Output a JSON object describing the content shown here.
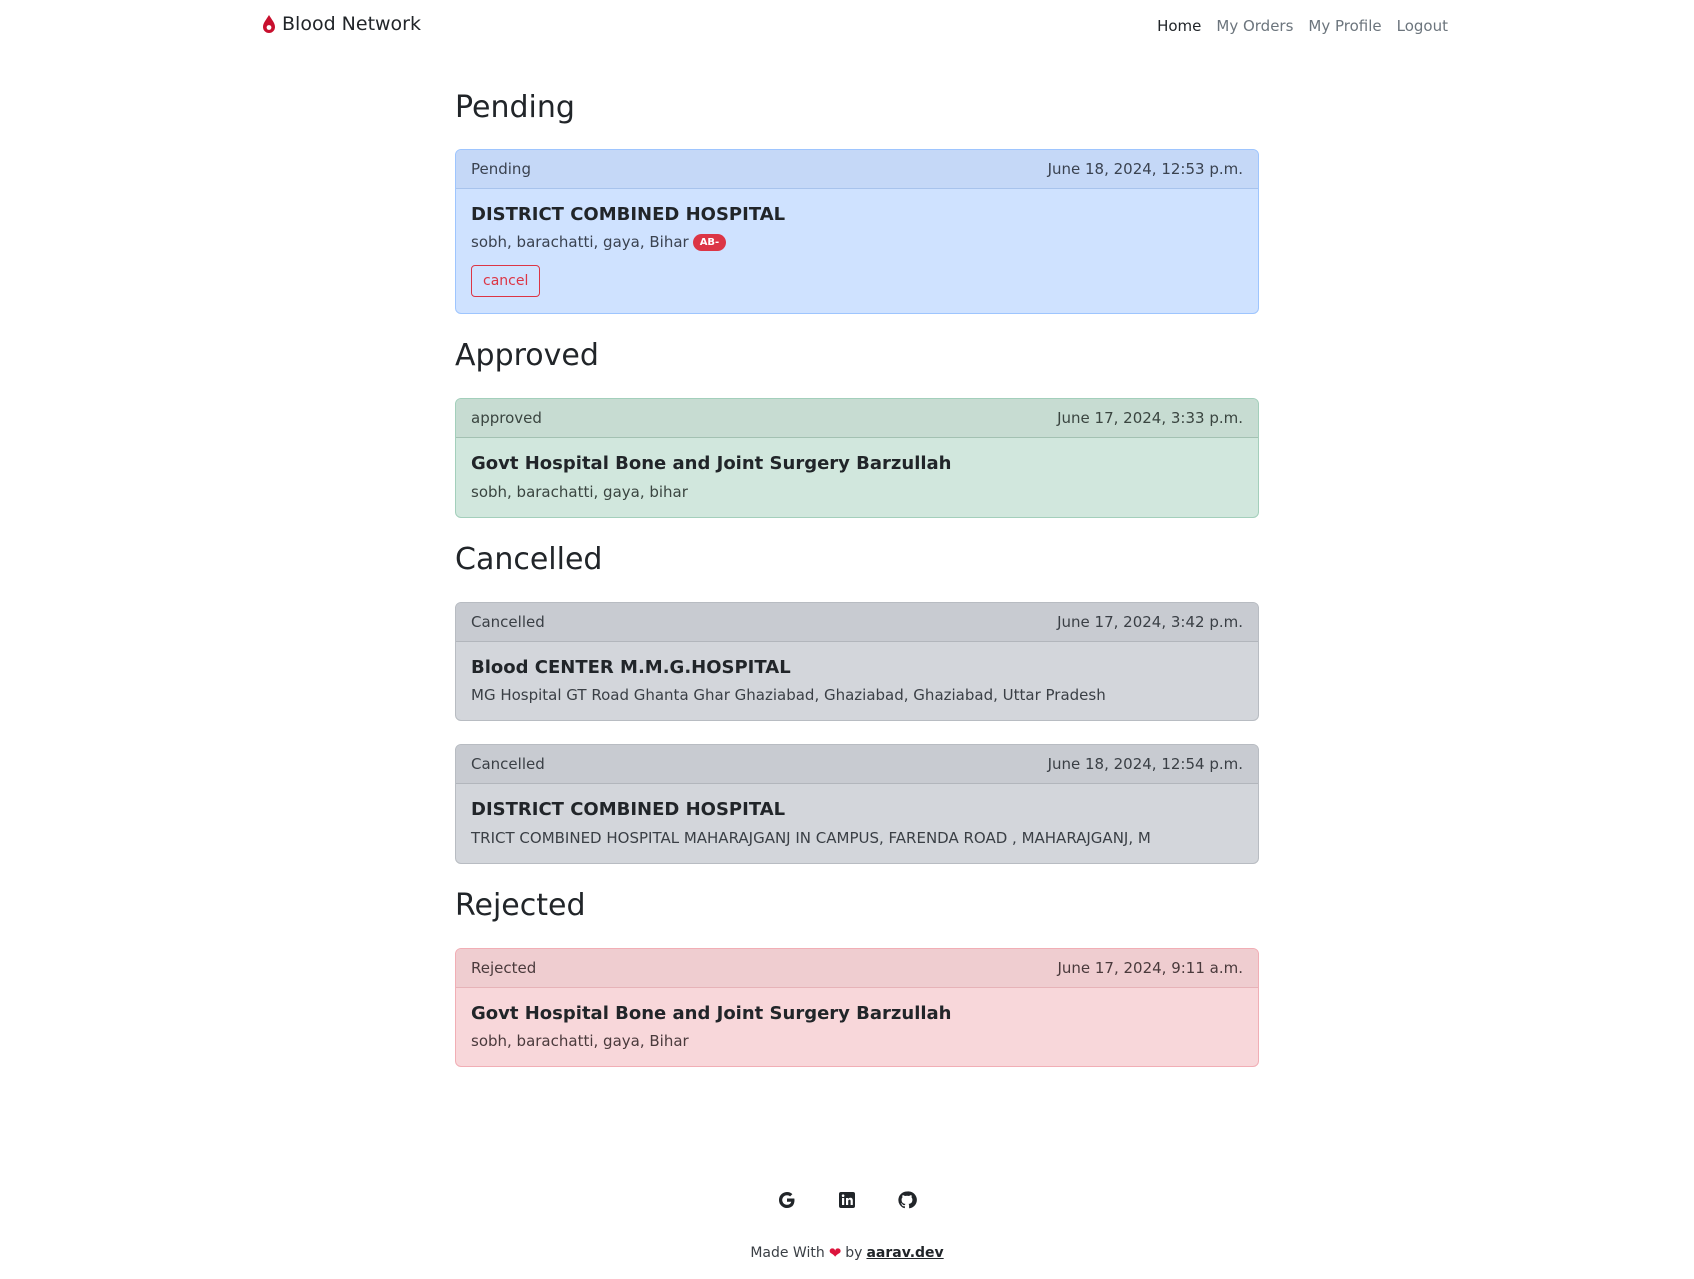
{
  "nav": {
    "brand": "Blood Network",
    "links": [
      "Home",
      "My Orders",
      "My Profile",
      "Logout"
    ]
  },
  "sections": {
    "pending": {
      "title": "Pending",
      "cards": [
        {
          "status": "Pending",
          "date": "June 18, 2024, 12:53 p.m.",
          "hospital": "DISTRICT COMBINED HOSPITAL",
          "address": "sobh, barachatti, gaya, Bihar",
          "blood_group": "AB-",
          "cancel_label": "cancel"
        }
      ]
    },
    "approved": {
      "title": "Approved",
      "cards": [
        {
          "status": "approved",
          "date": "June 17, 2024, 3:33 p.m.",
          "hospital": "Govt Hospital Bone and Joint Surgery Barzullah",
          "address": "sobh, barachatti, gaya, bihar"
        }
      ]
    },
    "cancelled": {
      "title": "Cancelled",
      "cards": [
        {
          "status": "Cancelled",
          "date": "June 17, 2024, 3:42 p.m.",
          "hospital": "Blood CENTER M.M.G.HOSPITAL",
          "address": "MG Hospital GT Road Ghanta Ghar Ghaziabad, Ghaziabad, Ghaziabad, Uttar Pradesh"
        },
        {
          "status": "Cancelled",
          "date": "June 18, 2024, 12:54 p.m.",
          "hospital": "DISTRICT COMBINED HOSPITAL",
          "address": "TRICT COMBINED HOSPITAL MAHARAJGANJ IN CAMPUS, FARENDA ROAD , MAHARAJGANJ, M"
        }
      ]
    },
    "rejected": {
      "title": "Rejected",
      "cards": [
        {
          "status": "Rejected",
          "date": "June 17, 2024, 9:11 a.m.",
          "hospital": "Govt Hospital Bone and Joint Surgery Barzullah",
          "address": "sobh, barachatti, gaya, Bihar"
        }
      ]
    }
  },
  "footer": {
    "icons": [
      "google-icon",
      "linkedin-icon",
      "github-icon"
    ],
    "made_with": "Made With",
    "by": "by",
    "author": "aarav.dev"
  },
  "colors": {
    "brand_red": "#dc3545",
    "pending_bg": "#cfe2ff",
    "approved_bg": "#d1e7dd",
    "cancelled_bg": "#d3d6db",
    "rejected_bg": "#f8d7da"
  }
}
